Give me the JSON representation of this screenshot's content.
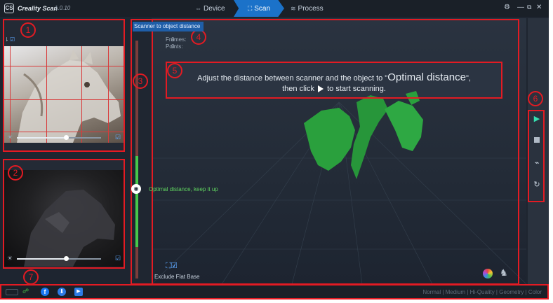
{
  "app": {
    "name": "Creality Scan",
    "version": "1.0.10",
    "logo_text": "CS"
  },
  "steps": {
    "device": "Device",
    "scan": "Scan",
    "process": "Process"
  },
  "window_controls": {
    "settings_icon": "gear-icon",
    "minimize": "—",
    "maximize": "⧉",
    "close": "✕"
  },
  "meter": {
    "label": "Scanner to object distance",
    "status_text": "Optimal distance, keep it up"
  },
  "stats": {
    "frames_label": "Frames:",
    "frames_value": "0",
    "points_label": "Points:",
    "points_value": "0"
  },
  "instruction": {
    "part1": "Adjust the distance between scanner and the object to \"",
    "strong": "Optimal distance",
    "part2": "\",",
    "line2_before": "then click",
    "line2_after": "to start scanning."
  },
  "viewport": {
    "exclude_label": "Exclude Flat Base"
  },
  "status_bar": {
    "modes": "Normal | Medium | Hi-Quality | Geometry | Color"
  },
  "sliders": {
    "rgb_exposure_fraction": 0.58,
    "ir_exposure_fraction": 0.58
  },
  "annotations": [
    "1",
    "2",
    "3",
    "4",
    "5",
    "6",
    "7"
  ],
  "colors": {
    "accent": "#1b72c9",
    "optimal_green": "#48c84a",
    "annotation_red": "#e31b23",
    "play_teal": "#35e0b0"
  }
}
